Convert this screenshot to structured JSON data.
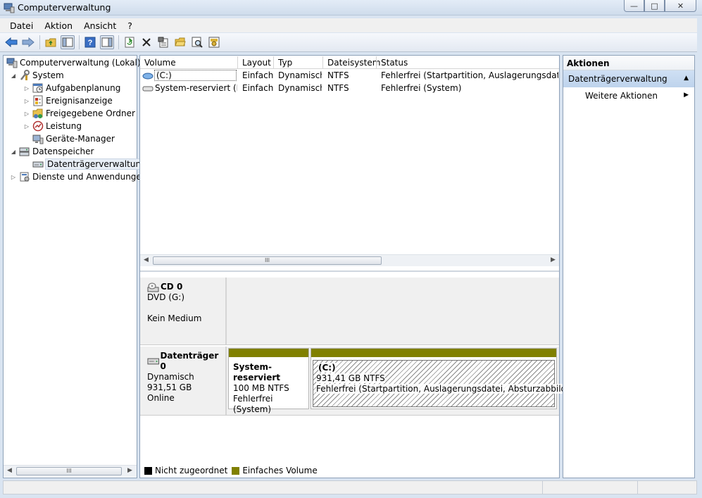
{
  "window": {
    "title": "Computerverwaltung",
    "minimize_glyph": "—",
    "maximize_glyph": "□",
    "close_glyph": "✕"
  },
  "menu": [
    "Datei",
    "Aktion",
    "Ansicht",
    "?"
  ],
  "toolbar": {
    "icons": [
      "back-arrow-icon",
      "forward-arrow-icon",
      "up-folder-icon",
      "show-hide-tree-icon",
      "help-icon",
      "show-hide-actions-icon",
      "refresh-icon",
      "delete-icon",
      "properties-icon",
      "open-icon",
      "search-icon",
      "settings-icon"
    ]
  },
  "tree": {
    "root": "Computerverwaltung (Lokal)",
    "system": "System",
    "aufgabenplanung": "Aufgabenplanung",
    "ereignisanzeige": "Ereignisanzeige",
    "freigegebene_ordner": "Freigegebene Ordner",
    "leistung": "Leistung",
    "geraete_manager": "Geräte-Manager",
    "datenspeicher": "Datenspeicher",
    "datentraegerverwaltung": "Datenträgerverwaltung",
    "dienste": "Dienste und Anwendungen"
  },
  "scroll_thumb": "III",
  "volumes": {
    "columns": [
      "Volume",
      "Layout",
      "Typ",
      "Dateisystem",
      "Status"
    ],
    "rows": [
      [
        "(C:)",
        "Einfach",
        "Dynamisch",
        "NTFS",
        "Fehlerfrei (Startpartition, Auslagerungsdatei, Abs"
      ],
      [
        "System-reserviert (H:)",
        "Einfach",
        "Dynamisch",
        "NTFS",
        "Fehlerfrei (System)"
      ]
    ]
  },
  "disks": {
    "cd": {
      "name": "CD 0",
      "line1": "DVD (G:)",
      "line2": "Kein Medium"
    },
    "disk0": {
      "name": "Datenträger 0",
      "type": "Dynamisch",
      "size": "931,51 GB",
      "state": "Online",
      "partitions": [
        {
          "name": "System-reserviert",
          "size": "100 MB NTFS",
          "status": "Fehlerfrei (System)"
        },
        {
          "name": "(C:)",
          "size": "931,41 GB NTFS",
          "status": "Fehlerfrei (Startpartition, Auslagerungsdatei, Absturzabbild)"
        }
      ]
    }
  },
  "legend": {
    "unallocated": "Nicht zugeordnet",
    "simple": "Einfaches Volume",
    "unallocated_color": "#000000",
    "simple_color": "#808000"
  },
  "actions": {
    "title": "Aktionen",
    "group": "Datenträgerverwaltung",
    "more": "Weitere Aktionen"
  }
}
